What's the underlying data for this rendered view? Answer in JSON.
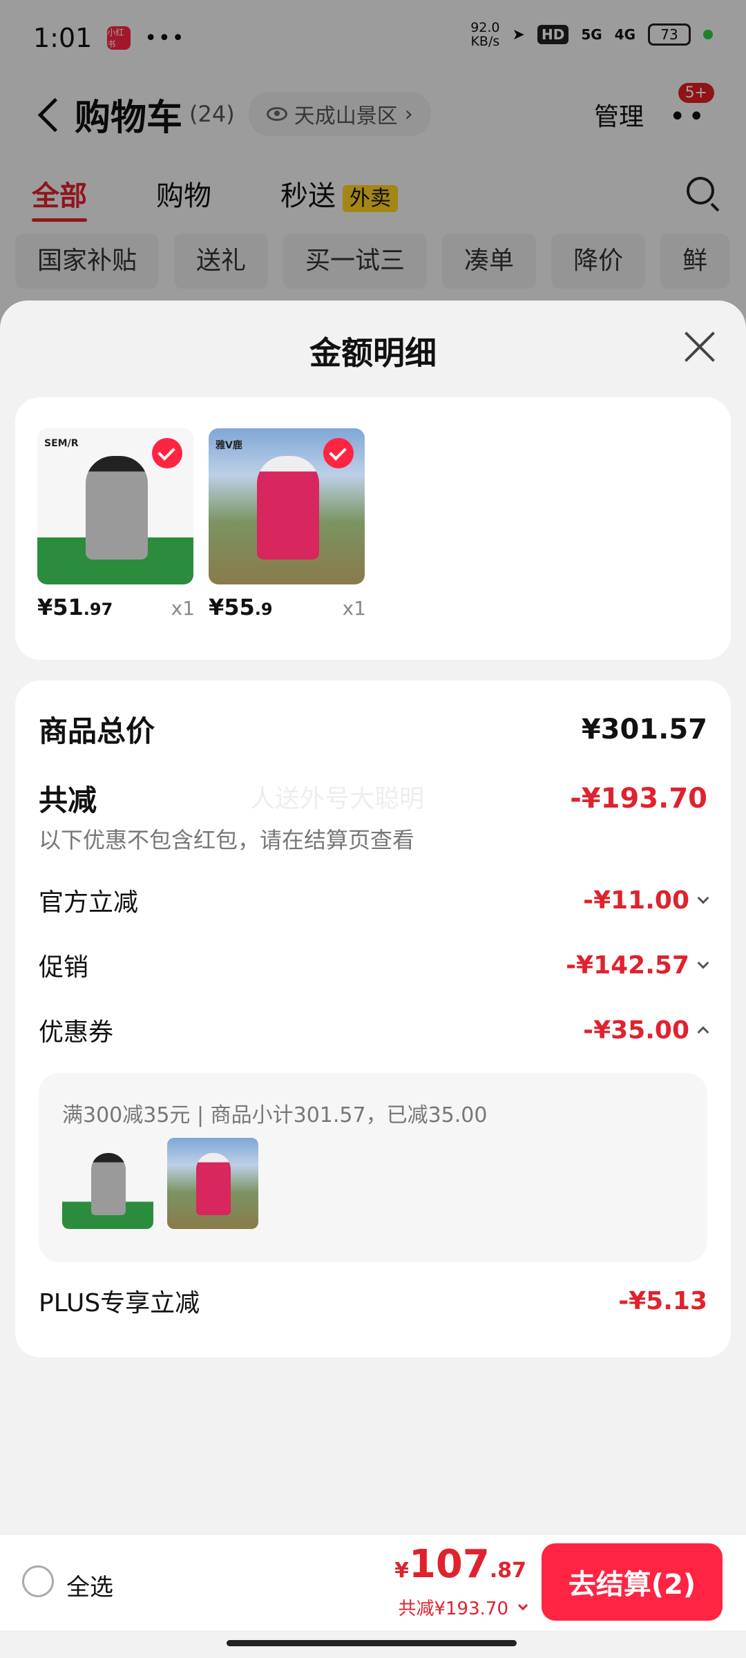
{
  "status": {
    "time": "1:01",
    "app": "小红书",
    "dots": "•••",
    "speed_top": "92.0",
    "speed_bottom": "KB/s",
    "hd": "HD",
    "net1": "5G",
    "net2": "4G",
    "battery": "73"
  },
  "header": {
    "title": "购物车",
    "count": "(24)",
    "location": "天成山景区",
    "location_chevron": "›",
    "manage": "管理",
    "more": "••",
    "badge": "5+"
  },
  "tabs": [
    {
      "label": "全部"
    },
    {
      "label": "购物"
    },
    {
      "label": "秒送"
    }
  ],
  "tab_tag": "外卖",
  "chips": [
    "国家补贴",
    "送礼",
    "买一试三",
    "凑单",
    "降价",
    "鲜"
  ],
  "sheet": {
    "title": "金额明细",
    "products": [
      {
        "brand": "SEM/R",
        "price_int": "¥51",
        "price_dec": ".97",
        "qty": "x1"
      },
      {
        "brand": "雅V鹿",
        "price_int": "¥55",
        "price_dec": ".9",
        "qty": "x1"
      }
    ],
    "total_label": "商品总价",
    "total_value": "¥301.57",
    "discount_label": "共减",
    "discount_value": "-¥193.70",
    "watermark": "人送外号大聪明",
    "note": "以下优惠不包含红包，请在结算页查看",
    "items": [
      {
        "label": "官方立减",
        "value": "-¥11.00"
      },
      {
        "label": "促销",
        "value": "-¥142.57"
      },
      {
        "label": "优惠券",
        "value": "-¥35.00"
      }
    ],
    "coupon_text": "满300减35元 | 商品小计301.57，已减35.00",
    "plus_label": "PLUS专享立减",
    "plus_value": "-¥5.13"
  },
  "bottom": {
    "select_all": "全选",
    "yen": "¥",
    "total_int": "107",
    "total_dec": ".87",
    "saved": "共减¥193.70",
    "checkout": "去结算(2)"
  }
}
